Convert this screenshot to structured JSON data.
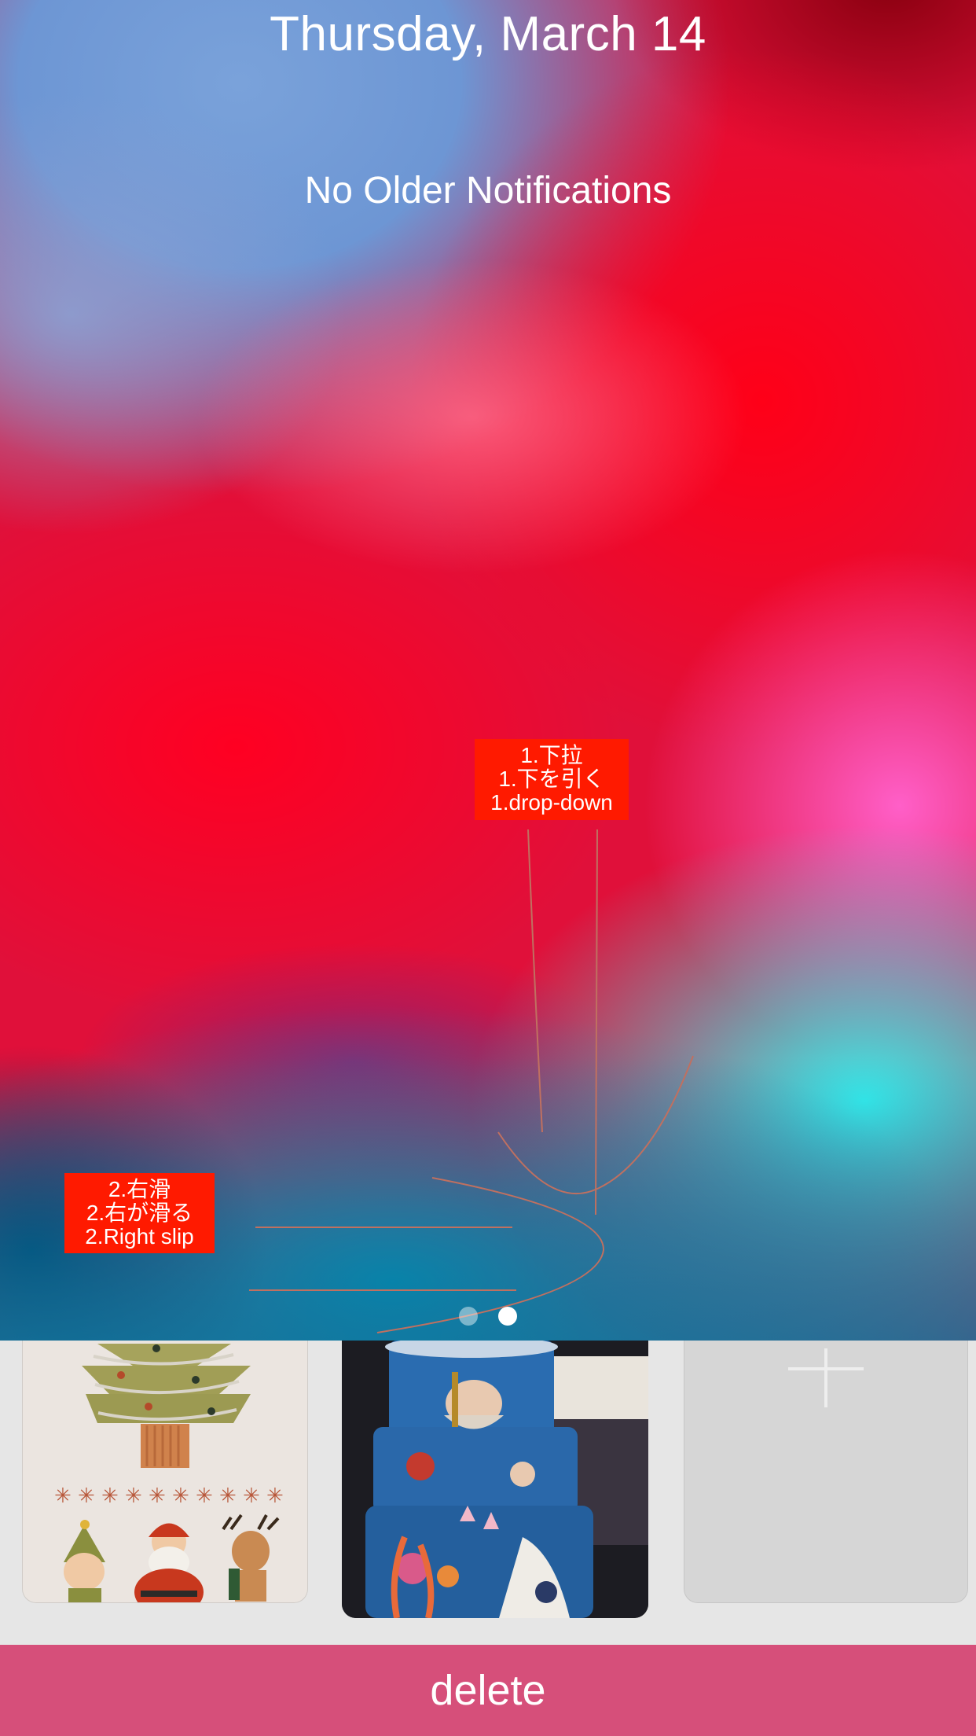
{
  "lock_screen": {
    "date": "Thursday, March 14",
    "notifications_status": "No Older Notifications",
    "page_indicator": {
      "count": 2,
      "active_index": 1
    }
  },
  "tips": {
    "pull_down": [
      "1.下拉",
      "1.下を引く",
      "1.drop-down"
    ],
    "right_slide": [
      "2.右滑",
      "2.右が滑る",
      "2.Right slip"
    ]
  },
  "wallpapers": [
    {
      "name": "christmas-wallpaper"
    },
    {
      "name": "cake-wallpaper"
    },
    {
      "name": "add-wallpaper",
      "icon": "plus-icon"
    }
  ],
  "actions": {
    "delete_label": "delete"
  },
  "colors": {
    "tip_background": "#ff1a00",
    "delete_bar": "#d64f7a",
    "background": "#e6e6e6"
  }
}
